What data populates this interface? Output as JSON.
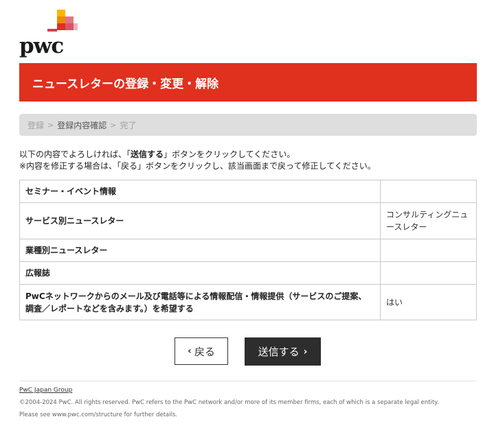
{
  "logo": {
    "text": "pwc",
    "colors": [
      "#e0301e",
      "#eb8c00",
      "#ffb600",
      "#d93954",
      "#db536a",
      "#e27588"
    ]
  },
  "banner": {
    "title": "ニュースレターの登録・変更・解除",
    "color": "#e0301e"
  },
  "steps": {
    "items": [
      {
        "label": "登録"
      },
      {
        "label": "登録内容確認"
      },
      {
        "label": "完了"
      }
    ],
    "separator": ">"
  },
  "instructions": {
    "line1_pre": "以下の内容でよろしければ、「",
    "line1_bold": "送信する",
    "line1_post": "」ボタンをクリックしてください。",
    "line2": "※内容を修正する場合は、「戻る」ボタンをクリックし、該当画面まで戻って修正してください。"
  },
  "table": {
    "rows": [
      {
        "label": "セミナー・イベント情報",
        "value": ""
      },
      {
        "label": "サービス別ニュースレター",
        "value": "コンサルティングニュースレター"
      },
      {
        "label": "業種別ニュースレター",
        "value": ""
      },
      {
        "label": "広報誌",
        "value": ""
      },
      {
        "label": "PwCネットワークからのメール及び電話等による情報配信・情報提供（サービスのご提案、調査／レポートなどを含みます。）を希望する",
        "value": "はい"
      }
    ]
  },
  "buttons": {
    "back_label": "戻る",
    "send_label": "送信する"
  },
  "footer": {
    "link": "PwC Japan Group",
    "copyright": "©2004-2024 PwC. All rights reserved. PwC refers to the PwC network and/or more of its member firms, each of which is a separate legal entity.",
    "see": "Please see www.pwc.com/structure for further details."
  }
}
